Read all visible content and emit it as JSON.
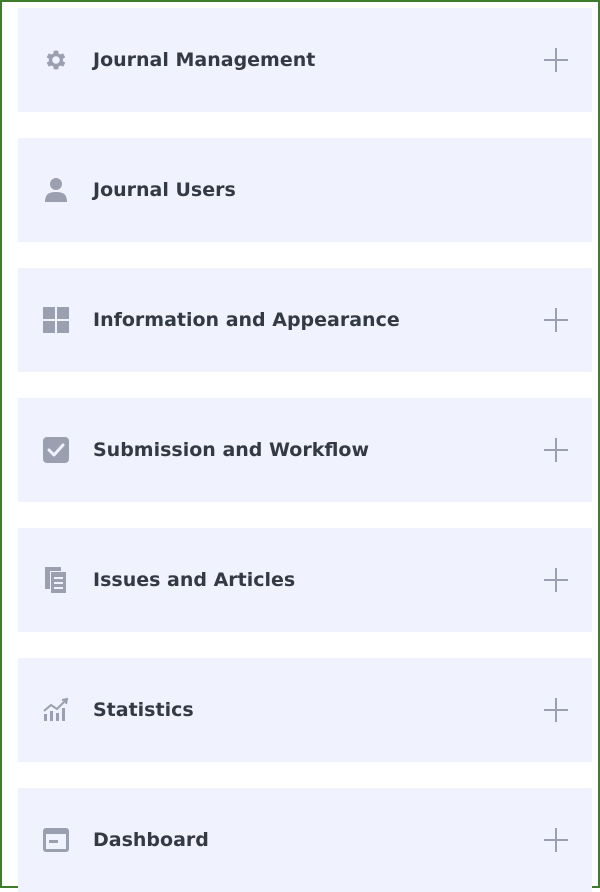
{
  "menu": {
    "icon_color": "#9aa0b0",
    "background": "#f0f3fd",
    "border_color": "#3e7d2b",
    "items": [
      {
        "label": "Journal Management",
        "icon": "gear-icon",
        "expandable": true
      },
      {
        "label": "Journal Users",
        "icon": "user-icon",
        "expandable": false
      },
      {
        "label": "Information and Appearance",
        "icon": "grid-icon",
        "expandable": true
      },
      {
        "label": "Submission and Workflow",
        "icon": "checkbox-icon",
        "expandable": true
      },
      {
        "label": "Issues and Articles",
        "icon": "documents-icon",
        "expandable": true
      },
      {
        "label": "Statistics",
        "icon": "chart-icon",
        "expandable": true
      },
      {
        "label": "Dashboard",
        "icon": "dashboard-icon",
        "expandable": true
      }
    ]
  }
}
